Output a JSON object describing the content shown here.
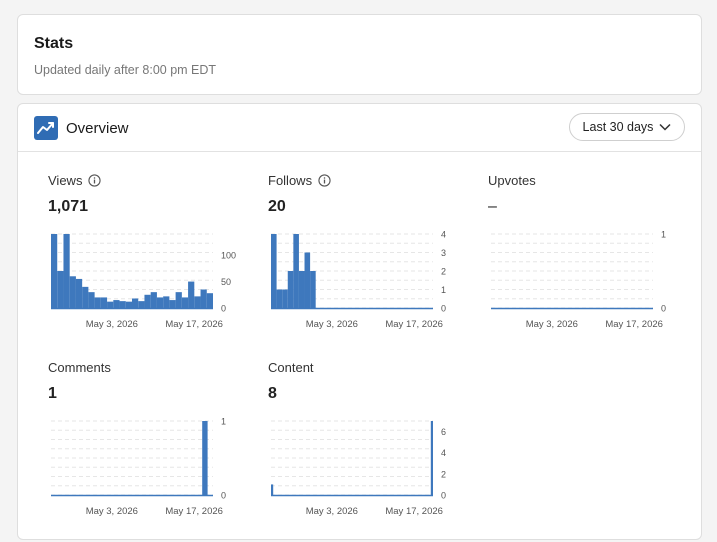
{
  "stats": {
    "title": "Stats",
    "subtitle": "Updated daily after 8:00 pm EDT"
  },
  "overview": {
    "title": "Overview",
    "icon": "trending-up-icon",
    "range_label": "Last 30 days",
    "accent": "#3e78bd"
  },
  "metrics": [
    {
      "key": "views",
      "label": "Views",
      "has_info": true,
      "value": "1,071"
    },
    {
      "key": "follows",
      "label": "Follows",
      "has_info": true,
      "value": "20"
    },
    {
      "key": "upvotes",
      "label": "Upvotes",
      "has_info": false,
      "value": "–"
    },
    {
      "key": "comments",
      "label": "Comments",
      "has_info": false,
      "value": "1"
    },
    {
      "key": "content",
      "label": "Content",
      "has_info": false,
      "value": "8"
    }
  ],
  "chart_data": [
    {
      "type": "bar",
      "title": "Views",
      "x_tick_labels": [
        "May 3, 2026",
        "May 17, 2026"
      ],
      "y_ticks": [
        0,
        50,
        100
      ],
      "ylim": [
        0,
        140
      ],
      "values": [
        140,
        70,
        140,
        60,
        55,
        40,
        30,
        20,
        20,
        12,
        15,
        13,
        12,
        18,
        13,
        25,
        30,
        20,
        22,
        15,
        30,
        20,
        50,
        22,
        35,
        28
      ]
    },
    {
      "type": "bar",
      "title": "Follows",
      "x_tick_labels": [
        "May 3, 2026",
        "May 17, 2026"
      ],
      "y_ticks": [
        0,
        1,
        2,
        3,
        4
      ],
      "ylim": [
        0,
        4
      ],
      "values": [
        4,
        1,
        1,
        2,
        4,
        2,
        3,
        2,
        0,
        0,
        0,
        0,
        0,
        0,
        0,
        0,
        0,
        0,
        0,
        0,
        0,
        0,
        0,
        0,
        0,
        0,
        0,
        0,
        0
      ]
    },
    {
      "type": "bar",
      "title": "Upvotes",
      "x_tick_labels": [
        "May 3, 2026",
        "May 17, 2026"
      ],
      "y_ticks": [
        0,
        1
      ],
      "ylim": [
        0,
        1
      ],
      "values": [
        0,
        0,
        0,
        0,
        0,
        0,
        0,
        0,
        0,
        0,
        0,
        0,
        0,
        0,
        0,
        0,
        0,
        0,
        0,
        0,
        0,
        0,
        0,
        0,
        0,
        0,
        0,
        0,
        0,
        0
      ]
    },
    {
      "type": "bar",
      "title": "Comments",
      "x_tick_labels": [
        "May 3, 2026",
        "May 17, 2026"
      ],
      "y_ticks": [
        0,
        1
      ],
      "ylim": [
        0,
        1
      ],
      "values": [
        0,
        0,
        0,
        0,
        0,
        0,
        0,
        0,
        0,
        0,
        0,
        0,
        0,
        0,
        0,
        0,
        0,
        0,
        0,
        0,
        0,
        0,
        0,
        0,
        0,
        0,
        0,
        0,
        1,
        0
      ]
    },
    {
      "type": "bar",
      "title": "Content",
      "x_tick_labels": [
        "May 3, 2026",
        "May 17, 2026"
      ],
      "y_ticks": [
        0,
        2,
        4,
        6
      ],
      "ylim": [
        0,
        7
      ],
      "values": [
        1,
        0,
        0,
        0,
        0,
        0,
        0,
        0,
        0,
        0,
        0,
        0,
        0,
        0,
        0,
        0,
        0,
        0,
        0,
        0,
        0,
        0,
        0,
        0,
        0,
        0,
        0,
        0,
        0,
        0,
        0,
        0,
        0,
        0,
        0,
        0,
        0,
        0,
        0,
        0,
        0,
        0,
        0,
        0,
        0,
        0,
        0,
        0,
        0,
        0,
        0,
        0,
        0,
        0,
        0,
        0,
        0,
        0,
        0,
        0,
        0,
        0,
        0,
        0,
        0,
        0,
        0,
        0,
        0,
        0,
        0,
        0,
        0,
        7
      ]
    }
  ]
}
